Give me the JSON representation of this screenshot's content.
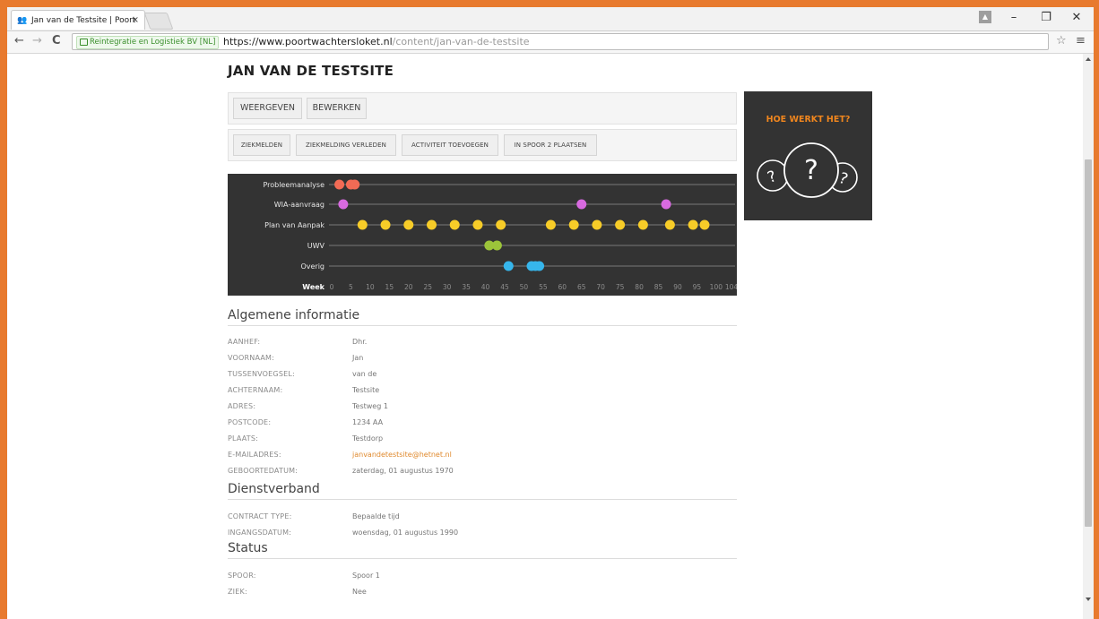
{
  "browser": {
    "tab_title": "Jan van de Testsite | Poort",
    "tab_close": "×",
    "favicon": "people-icon",
    "secure_label": "Reintegratie en Logistiek BV [NL]",
    "url_host": "https://www.poortwachtersloket.nl",
    "url_path": "/content/jan-van-de-testsite",
    "controls": {
      "minimize": "–",
      "maximize": "❐",
      "close": "✕",
      "back": "←",
      "forward": "→",
      "reload": "C",
      "star": "☆",
      "menu": "≡",
      "user": "▲"
    }
  },
  "page": {
    "title": "JAN VAN DE TESTSITE",
    "tabs": [
      {
        "label": "WEERGEVEN"
      },
      {
        "label": "BEWERKEN"
      }
    ],
    "actions": [
      {
        "label": "ZIEKMELDEN"
      },
      {
        "label": "ZIEKMELDING VERLEDEN"
      },
      {
        "label": "ACTIVITEIT TOEVOEGEN"
      },
      {
        "label": "IN SPOOR 2 PLAATSEN"
      }
    ]
  },
  "help": {
    "title": "HOE WERKT HET?",
    "glyph": "?"
  },
  "chart_data": {
    "type": "scatter",
    "xlabel": "Week",
    "x_ticks": [
      "0",
      "5",
      "10",
      "15",
      "20",
      "25",
      "30",
      "35",
      "40",
      "45",
      "50",
      "55",
      "60",
      "65",
      "70",
      "75",
      "80",
      "85",
      "90",
      "95",
      "100",
      "104"
    ],
    "xlim": [
      0,
      104
    ],
    "grid": true,
    "series": [
      {
        "name": "Probleemanalyse",
        "color": "#f26b55",
        "x": [
          2,
          5,
          6
        ]
      },
      {
        "name": "WIA-aanvraag",
        "color": "#d86ae0",
        "x": [
          3,
          65,
          87
        ]
      },
      {
        "name": "Plan van Aanpak",
        "color": "#f7cc28",
        "x": [
          8,
          14,
          20,
          26,
          32,
          38,
          44,
          57,
          63,
          69,
          75,
          81,
          88,
          94,
          97
        ]
      },
      {
        "name": "UWV",
        "color": "#9cc43a",
        "x": [
          41,
          43
        ]
      },
      {
        "name": "Overig",
        "color": "#36b6ec",
        "x": [
          46,
          52,
          53,
          54
        ]
      }
    ]
  },
  "sections": [
    {
      "heading": "Algemene informatie",
      "rows": [
        {
          "label": "AANHEF:",
          "value": "Dhr."
        },
        {
          "label": "VOORNAAM:",
          "value": "Jan"
        },
        {
          "label": "TUSSENVOEGSEL:",
          "value": "van de"
        },
        {
          "label": "ACHTERNAAM:",
          "value": "Testsite"
        },
        {
          "label": "ADRES:",
          "value": "Testweg 1"
        },
        {
          "label": "POSTCODE:",
          "value": "1234 AA"
        },
        {
          "label": "PLAATS:",
          "value": "Testdorp"
        },
        {
          "label": "E-MAILADRES:",
          "value": "janvandetestsite@hetnet.nl"
        },
        {
          "label": "GEBOORTEDATUM:",
          "value": "zaterdag, 01 augustus 1970"
        }
      ]
    },
    {
      "heading": "Dienstverband",
      "rows": [
        {
          "label": "CONTRACT TYPE:",
          "value": "Bepaalde tijd"
        },
        {
          "label": "INGANGSDATUM:",
          "value": "woensdag, 01 augustus 1990"
        }
      ]
    },
    {
      "heading": "Status",
      "rows": [
        {
          "label": "SPOOR:",
          "value": "Spoor 1"
        },
        {
          "label": "ZIEK:",
          "value": "Nee"
        }
      ]
    }
  ]
}
